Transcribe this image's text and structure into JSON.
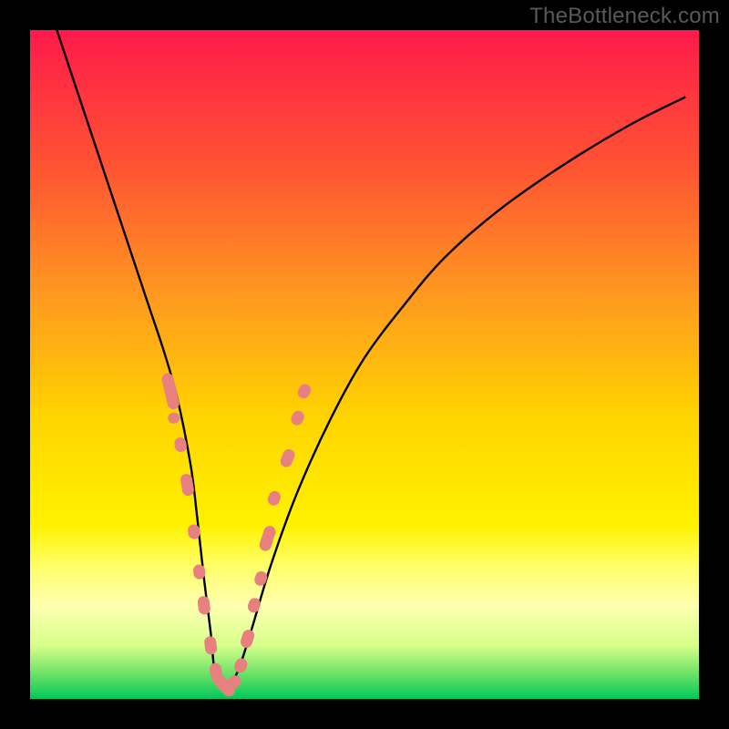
{
  "watermark": "TheBottleneck.com",
  "chart_data": {
    "type": "line",
    "title": "",
    "xlabel": "",
    "ylabel": "",
    "xlim": [
      0,
      100
    ],
    "ylim": [
      0,
      100
    ],
    "grid": false,
    "legend": false,
    "gradient_stops": [
      {
        "offset": 0,
        "color": "#ff1a4b"
      },
      {
        "offset": 0.2,
        "color": "#ff5233"
      },
      {
        "offset": 0.4,
        "color": "#ff9a1f"
      },
      {
        "offset": 0.58,
        "color": "#ffd400"
      },
      {
        "offset": 0.74,
        "color": "#fff200"
      },
      {
        "offset": 0.8,
        "color": "#ffff66"
      },
      {
        "offset": 0.86,
        "color": "#ffffb0"
      },
      {
        "offset": 0.92,
        "color": "#d6ff8a"
      },
      {
        "offset": 0.965,
        "color": "#66e066"
      },
      {
        "offset": 1.0,
        "color": "#00c85a"
      }
    ],
    "series": [
      {
        "name": "bottleneck-curve",
        "color": "#000000",
        "x": [
          4,
          8,
          12,
          16,
          18,
          20,
          22,
          24,
          25,
          26,
          27,
          27.6,
          28.5,
          29.5,
          31,
          33,
          36,
          40,
          45,
          50,
          56,
          62,
          70,
          80,
          90,
          98
        ],
        "y": [
          100,
          88,
          76,
          64,
          58,
          52,
          45,
          35,
          27,
          18,
          10,
          4,
          2,
          2,
          4,
          10,
          20,
          31,
          42,
          51,
          59,
          66,
          73,
          80,
          86,
          90
        ]
      }
    ],
    "markers": {
      "name": "highlighted-points",
      "color": "#e98080",
      "shape": "rounded-pill",
      "points": [
        {
          "x": 21.0,
          "y": 46,
          "len": 10
        },
        {
          "x": 21.5,
          "y": 42,
          "len": 3
        },
        {
          "x": 22.5,
          "y": 38,
          "len": 4
        },
        {
          "x": 23.5,
          "y": 32,
          "len": 6
        },
        {
          "x": 24.5,
          "y": 25,
          "len": 4
        },
        {
          "x": 25.3,
          "y": 19,
          "len": 4
        },
        {
          "x": 26.0,
          "y": 14,
          "len": 5
        },
        {
          "x": 27.0,
          "y": 8,
          "len": 5
        },
        {
          "x": 27.8,
          "y": 4,
          "len": 5
        },
        {
          "x": 29.0,
          "y": 2,
          "len": 7
        },
        {
          "x": 30.5,
          "y": 2.5,
          "len": 4
        },
        {
          "x": 31.5,
          "y": 5,
          "len": 4
        },
        {
          "x": 32.5,
          "y": 9,
          "len": 5
        },
        {
          "x": 33.5,
          "y": 14,
          "len": 4
        },
        {
          "x": 34.5,
          "y": 18,
          "len": 4
        },
        {
          "x": 35.5,
          "y": 24,
          "len": 7
        },
        {
          "x": 36.5,
          "y": 30,
          "len": 4
        },
        {
          "x": 38.5,
          "y": 36,
          "len": 5
        },
        {
          "x": 40.0,
          "y": 42,
          "len": 4
        },
        {
          "x": 41.0,
          "y": 46,
          "len": 4
        }
      ]
    }
  }
}
